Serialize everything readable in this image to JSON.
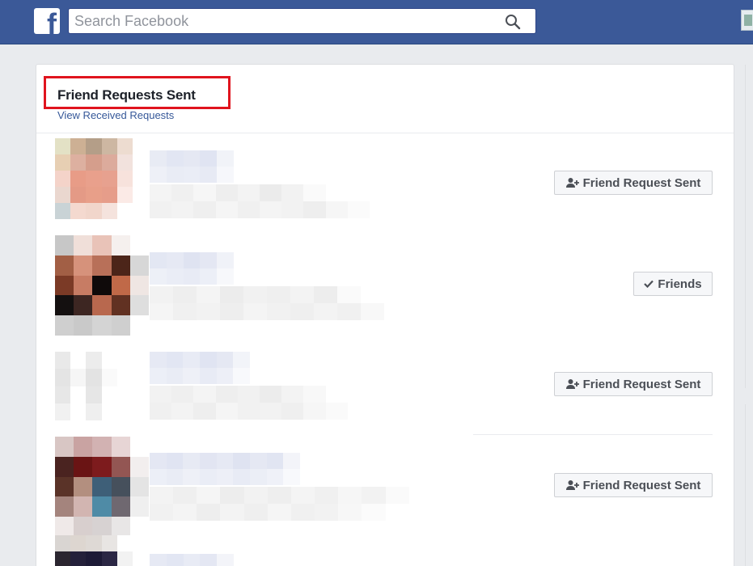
{
  "header": {
    "logo_letter": "f",
    "search_placeholder": "Search Facebook"
  },
  "panel": {
    "title": "Friend Requests Sent",
    "link": "View Received Requests"
  },
  "requests": [
    {
      "action_label": "Friend Request Sent",
      "action_icon": "add-friend-icon"
    },
    {
      "action_label": "Friends",
      "action_icon": "check-icon"
    },
    {
      "action_label": "Friend Request Sent",
      "action_icon": "add-friend-icon"
    },
    {
      "action_label": "Friend Request Sent",
      "action_icon": "add-friend-icon"
    }
  ],
  "colors": {
    "topbar": "#3b5998",
    "link": "#365899",
    "highlight_box": "#e0141e"
  }
}
